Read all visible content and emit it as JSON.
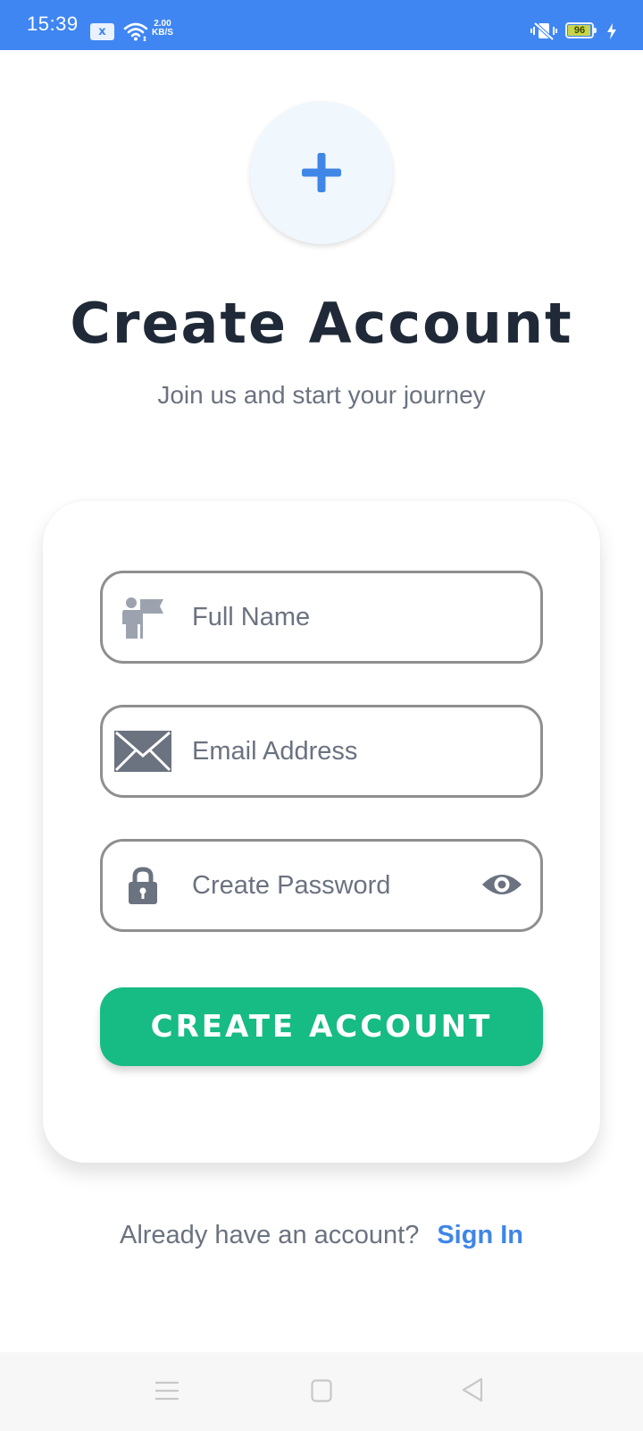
{
  "status_bar": {
    "time": "15:39",
    "notification_label": "x",
    "network_speed_value": "2.00",
    "network_speed_unit": "KB/S",
    "battery_level": "96",
    "battery_fraction": 0.96
  },
  "header": {
    "title": "Create Account",
    "subtitle": "Join us and start your journey"
  },
  "form": {
    "full_name_placeholder": "Full Name",
    "email_placeholder": "Email Address",
    "password_placeholder": "Create Password",
    "submit_label": "CREATE ACCOUNT"
  },
  "footer": {
    "prompt": "Already have an account?",
    "link_label": "Sign In"
  },
  "icons": {
    "logo": "plus-icon",
    "full_name": "person-flag-icon",
    "email": "envelope-icon",
    "password": "lock-icon",
    "password_toggle": "eye-icon"
  },
  "colors": {
    "status_bar": "#3f86f3",
    "accent_blue": "#3f86e6",
    "button_green": "#17bb84",
    "title_text": "#1f2937",
    "muted_text": "#6b7280",
    "icon_gray": "#6b7280"
  }
}
